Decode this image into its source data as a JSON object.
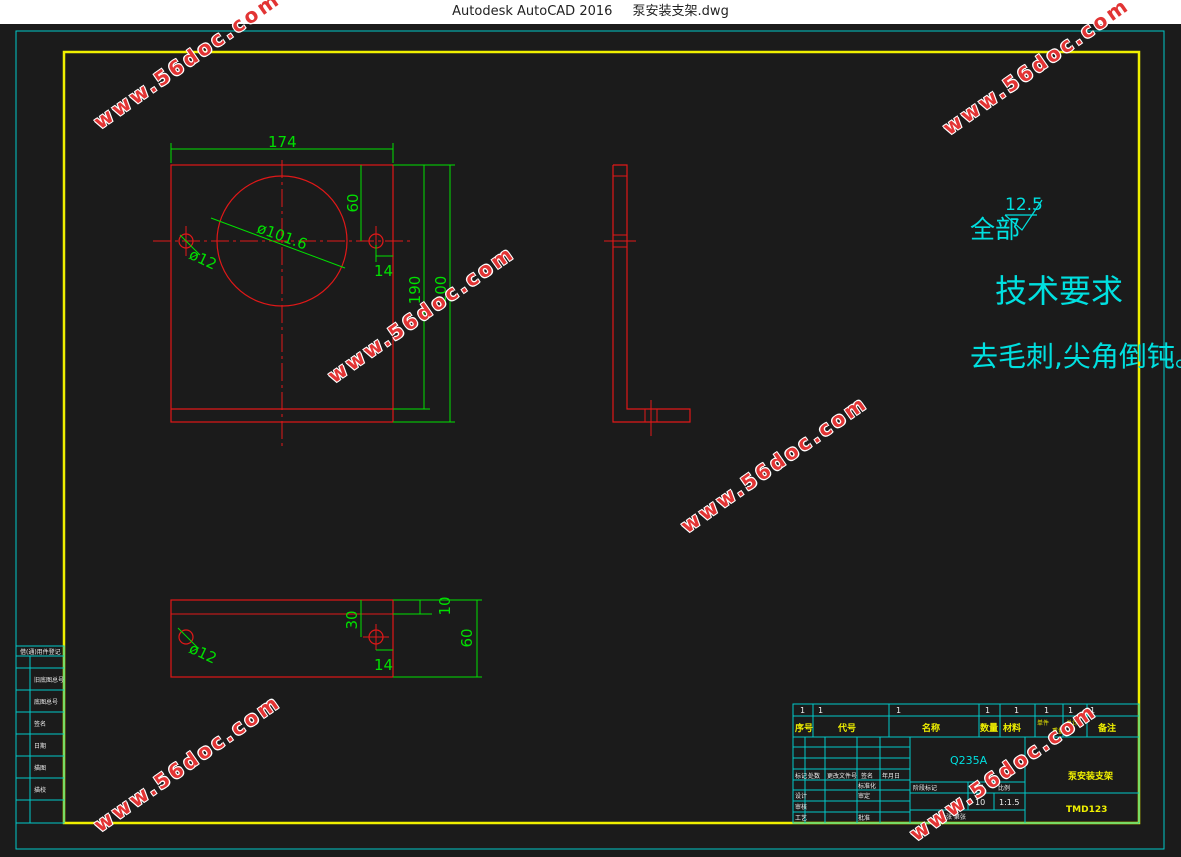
{
  "window": {
    "app_title": "Autodesk AutoCAD 2016",
    "file_name": "泵安装支架.dwg"
  },
  "colors": {
    "background": "#1b1b1b",
    "frame_outer": "#00c8c8",
    "frame_inner": "#f0f000",
    "part": "#e01818",
    "dimension": "#00e000",
    "notes": "#00e0e0",
    "watermark": "#e23434"
  },
  "drawing": {
    "front_view": {
      "dim_width": "174",
      "dim_height_total": "200",
      "dim_height_inner": "190",
      "dim_hole_offset_v": "60",
      "dim_hole_edge": "14",
      "dim_circle": "ø101.6",
      "dim_hole": "ø12"
    },
    "bottom_view": {
      "dim_hole_offset": "30",
      "dim_thickness": "10",
      "dim_depth": "60",
      "dim_hole_edge": "14",
      "dim_hole": "ø12"
    }
  },
  "notes": {
    "roughness_prefix": "全部",
    "roughness_value": "12.5",
    "tech_title": "技术要求",
    "tech_body": "去毛刺,尖角倒钝。"
  },
  "title_block": {
    "bom_index": [
      "1",
      "1",
      "1",
      "1",
      "1",
      "1",
      "1",
      "1"
    ],
    "bom_headers": {
      "seq": "序号",
      "code": "代号",
      "name": "名称",
      "qty": "数量",
      "material": "材料",
      "single": "单件",
      "total": "总计",
      "weight": "重量",
      "remark": "备注"
    },
    "material_spec": "Q235A",
    "drawing_name": "泵安装支架",
    "drawing_number": "TMD123",
    "sheet_count": "10",
    "scale": "1:1.5",
    "rev_labels": [
      "标记",
      "处数",
      "更改文件号",
      "签名",
      "年月日"
    ],
    "role_labels": [
      "设计",
      "审核",
      "工艺",
      "标准化",
      "审定",
      "批准"
    ],
    "stage_label": "阶段标记",
    "weight_label": "重量",
    "scale_label": "比例",
    "sheet_label": "共张 第张"
  },
  "side_block": {
    "labels": [
      "借(通)用件登记",
      "旧底图总号",
      "底图总号",
      "签名",
      "日期",
      "描图",
      "描校"
    ]
  },
  "watermark": "www.56doc.com"
}
